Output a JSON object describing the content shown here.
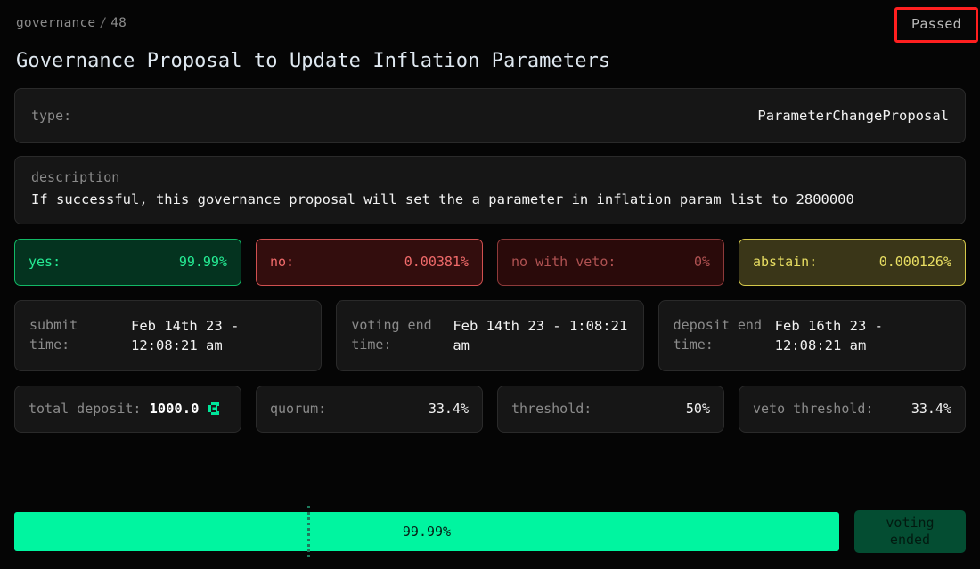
{
  "breadcrumb": {
    "root": "governance",
    "separator": "/",
    "id": "48"
  },
  "status": {
    "label": "Passed",
    "highlight_color": "#ff1f1f"
  },
  "title": "Governance Proposal to Update Inflation Parameters",
  "type_card": {
    "label": "type:",
    "value": "ParameterChangeProposal"
  },
  "description_card": {
    "label": "description",
    "text": "If successful, this governance proposal will set the a parameter in inflation param list to 2800000"
  },
  "tally": [
    {
      "key": "yes",
      "label": "yes:",
      "value": "99.99%",
      "color": "#25ec94"
    },
    {
      "key": "no",
      "label": "no:",
      "value": "0.00381%",
      "color": "#f06a6a"
    },
    {
      "key": "no_with_veto",
      "label": "no with veto:",
      "value": "0%",
      "color": "#b05252"
    },
    {
      "key": "abstain",
      "label": "abstain:",
      "value": "0.000126%",
      "color": "#e8de62"
    }
  ],
  "times": [
    {
      "key": "submit",
      "label": "submit time:",
      "value": "Feb 14th 23 - 12:08:21 am"
    },
    {
      "key": "voting_end",
      "label": "voting end time:",
      "value": "Feb 14th 23 - 1:08:21 am"
    },
    {
      "key": "deposit_end",
      "label": "deposit end time:",
      "value": "Feb 16th 23 - 12:08:21 am"
    }
  ],
  "params": {
    "total_deposit": {
      "label": "total deposit:",
      "value": "1000.0",
      "icon": "token-icon",
      "icon_color": "#00e599"
    },
    "quorum": {
      "label": "quorum:",
      "value": "33.4%"
    },
    "threshold": {
      "label": "threshold:",
      "value": "50%"
    },
    "veto_threshold": {
      "label": "veto threshold:",
      "value": "33.4%"
    }
  },
  "progress": {
    "percent_label": "99.99%",
    "fill_percent": 100,
    "quorum_marker_percent": 35.5,
    "fill_color": "#00f5a0",
    "marker_color": "#1d7a5c",
    "voting_badge_line1": "voting",
    "voting_badge_line2": "ended"
  }
}
